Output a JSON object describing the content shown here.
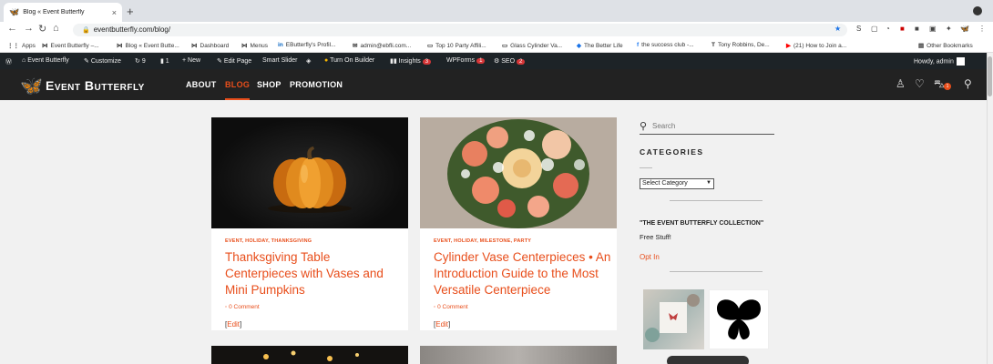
{
  "browser": {
    "tab_title": "Blog « Event Butterfly",
    "tab_close": "×",
    "new_tab": "+",
    "url": "eventbutterfly.com/blog/"
  },
  "bookmarks": [
    {
      "label": "Apps",
      "icon": "apps-icon"
    },
    {
      "label": "Event Butterfly –...",
      "icon": "butterfly-icon"
    },
    {
      "label": "Blog « Event Butte...",
      "icon": "butterfly-icon"
    },
    {
      "label": "Dashboard",
      "icon": "butterfly-icon"
    },
    {
      "label": "Menus",
      "icon": "butterfly-icon"
    },
    {
      "label": "EButterfly's Profil...",
      "icon": "linkedin-icon"
    },
    {
      "label": "admin@ebfli.com...",
      "icon": "mail-icon"
    },
    {
      "label": "Top 10 Party Affili...",
      "icon": "page-icon"
    },
    {
      "label": "Glass Cylinder Va...",
      "icon": "page-icon"
    },
    {
      "label": "The Better Life",
      "icon": "page-icon"
    },
    {
      "label": "the success club -...",
      "icon": "facebook-icon"
    },
    {
      "label": "Tony Robbins, De...",
      "icon": "page-icon"
    },
    {
      "label": "(21) How to Join a...",
      "icon": "youtube-icon"
    },
    {
      "label": "Other Bookmarks",
      "icon": "folder-icon"
    }
  ],
  "adminbar": {
    "site": "Event Butterfly",
    "customize": "Customize",
    "updates": "9",
    "comments": "1",
    "new": "New",
    "edit_page": "Edit Page",
    "smart_slider": "Smart Slider",
    "turn_on_builder": "Turn On Builder",
    "insights": "Insights",
    "insights_badge": "3",
    "wpforms": "WPForms",
    "wpforms_badge": "1",
    "seo": "SEO",
    "seo_badge": "2",
    "howdy": "Howdy, admin"
  },
  "site": {
    "logo_text": "Event Butterfly",
    "nav": [
      "ABOUT",
      "BLOG",
      "SHOP",
      "PROMOTION"
    ],
    "cart_count": "1",
    "accent": "#e84e1b"
  },
  "posts": [
    {
      "categories": "EVENT, HOLIDAY, THANKSGIVING",
      "title": "Thanksgiving Table Centerpieces with Vases and Mini Pumpkins",
      "comments": "0 Comment",
      "edit": "Edit"
    },
    {
      "categories": "EVENT, HOLIDAY, MILESTONE, PARTY",
      "title": "Cylinder Vase Centerpieces • An Introduction Guide to the Most Versatile Centerpiece",
      "comments": "0 Comment",
      "edit": "Edit"
    }
  ],
  "sidebar": {
    "search_placeholder": "Search",
    "categories_heading": "CATEGORIES",
    "select_category": "Select Category",
    "collection_title": "\"THE EVENT BUTTERFLY COLLECTION\"",
    "free_stuff": "Free Stuff!",
    "opt_in": "Opt In"
  }
}
